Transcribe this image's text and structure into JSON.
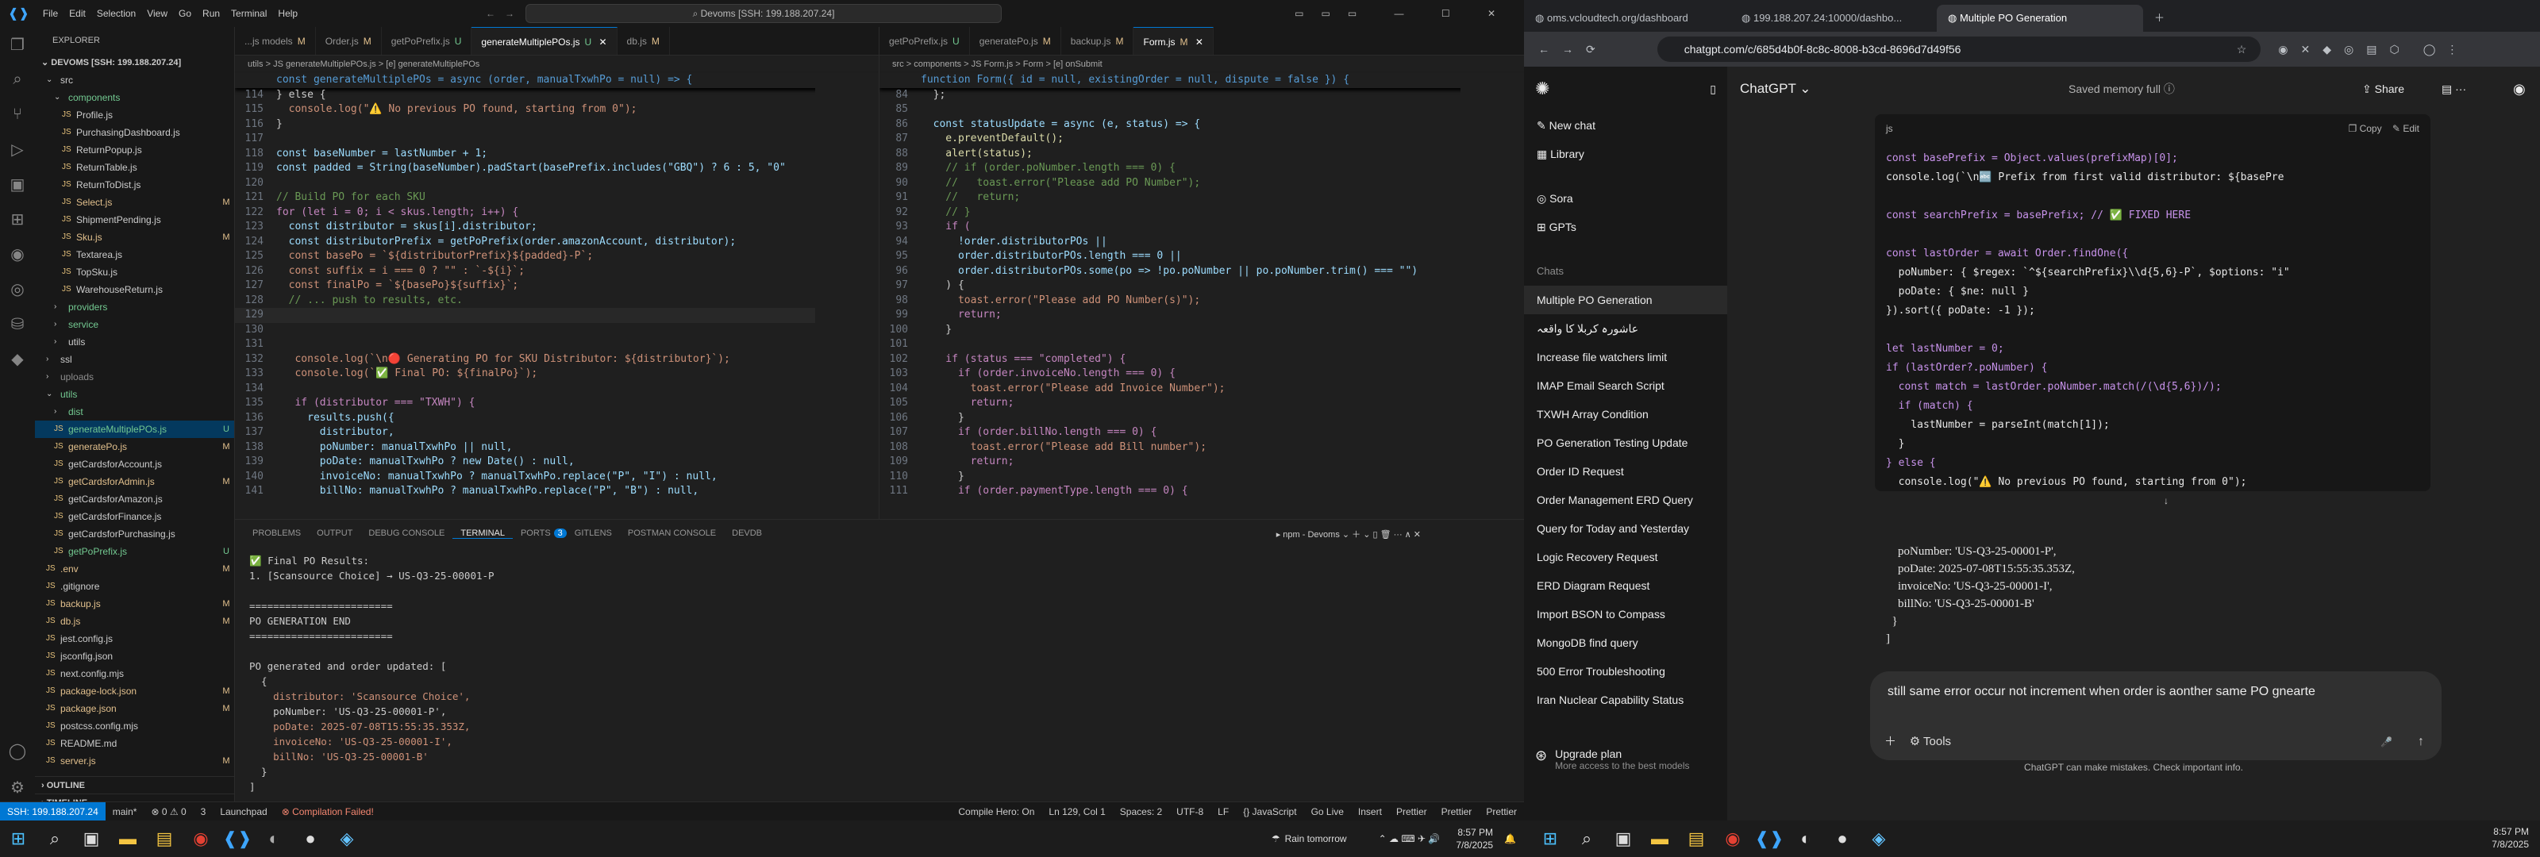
{
  "vscode": {
    "menu": [
      "File",
      "Edit",
      "Selection",
      "View",
      "Go",
      "Run",
      "Terminal",
      "Help"
    ],
    "command_center": "Devoms [SSH: 199.188.207.24]",
    "explorer_title": "EXPLORER",
    "workspace": "DEVOMS [SSH: 199.188.207.24]",
    "tree": [
      {
        "label": "src",
        "indent": 1,
        "folder": true,
        "open": true,
        "status": "",
        "color": "#ccc"
      },
      {
        "label": "components",
        "indent": 2,
        "folder": true,
        "open": true,
        "status": "",
        "color": "#73c991"
      },
      {
        "label": "Profile.js",
        "indent": 3,
        "folder": false,
        "status": "",
        "color": "#ccc"
      },
      {
        "label": "PurchasingDashboard.js",
        "indent": 3,
        "folder": false,
        "status": "",
        "color": "#ccc"
      },
      {
        "label": "ReturnPopup.js",
        "indent": 3,
        "folder": false,
        "status": "",
        "color": "#ccc"
      },
      {
        "label": "ReturnTable.js",
        "indent": 3,
        "folder": false,
        "status": "",
        "color": "#ccc"
      },
      {
        "label": "ReturnToDist.js",
        "indent": 3,
        "folder": false,
        "status": "",
        "color": "#ccc"
      },
      {
        "label": "Select.js",
        "indent": 3,
        "folder": false,
        "status": "M",
        "color": "#e2c08d"
      },
      {
        "label": "ShipmentPending.js",
        "indent": 3,
        "folder": false,
        "status": "",
        "color": "#ccc"
      },
      {
        "label": "Sku.js",
        "indent": 3,
        "folder": false,
        "status": "M",
        "color": "#e2c08d"
      },
      {
        "label": "Textarea.js",
        "indent": 3,
        "folder": false,
        "status": "",
        "color": "#ccc"
      },
      {
        "label": "TopSku.js",
        "indent": 3,
        "folder": false,
        "status": "",
        "color": "#ccc"
      },
      {
        "label": "WarehouseReturn.js",
        "indent": 3,
        "folder": false,
        "status": "",
        "color": "#ccc"
      },
      {
        "label": "providers",
        "indent": 2,
        "folder": true,
        "open": false,
        "status": "",
        "color": "#73c991"
      },
      {
        "label": "service",
        "indent": 2,
        "folder": true,
        "open": false,
        "status": "",
        "color": "#73c991"
      },
      {
        "label": "utils",
        "indent": 2,
        "folder": true,
        "open": false,
        "status": "",
        "color": "#ccc"
      },
      {
        "label": "ssl",
        "indent": 1,
        "folder": true,
        "open": false,
        "status": "",
        "color": "#ccc"
      },
      {
        "label": "uploads",
        "indent": 1,
        "folder": true,
        "open": false,
        "status": "",
        "color": "#8c8c8c"
      },
      {
        "label": "utils",
        "indent": 1,
        "folder": true,
        "open": true,
        "status": "",
        "color": "#73c991"
      },
      {
        "label": "dist",
        "indent": 2,
        "folder": true,
        "open": false,
        "status": "",
        "color": "#73c991"
      },
      {
        "label": "generateMultiplePOs.js",
        "indent": 2,
        "folder": false,
        "status": "U",
        "color": "#73c991",
        "selected": true
      },
      {
        "label": "generatePo.js",
        "indent": 2,
        "folder": false,
        "status": "M",
        "color": "#e2c08d"
      },
      {
        "label": "getCardsforAccount.js",
        "indent": 2,
        "folder": false,
        "status": "",
        "color": "#ccc"
      },
      {
        "label": "getCardsforAdmin.js",
        "indent": 2,
        "folder": false,
        "status": "M",
        "color": "#e2c08d"
      },
      {
        "label": "getCardsforAmazon.js",
        "indent": 2,
        "folder": false,
        "status": "",
        "color": "#ccc"
      },
      {
        "label": "getCardsforFinance.js",
        "indent": 2,
        "folder": false,
        "status": "",
        "color": "#ccc"
      },
      {
        "label": "getCardsforPurchasing.js",
        "indent": 2,
        "folder": false,
        "status": "",
        "color": "#ccc"
      },
      {
        "label": "getPoPrefix.js",
        "indent": 2,
        "folder": false,
        "status": "U",
        "color": "#73c991"
      },
      {
        "label": ".env",
        "indent": 1,
        "folder": false,
        "status": "M",
        "color": "#e2c08d"
      },
      {
        "label": ".gitignore",
        "indent": 1,
        "folder": false,
        "status": "",
        "color": "#ccc"
      },
      {
        "label": "backup.js",
        "indent": 1,
        "folder": false,
        "status": "M",
        "color": "#e2c08d"
      },
      {
        "label": "db.js",
        "indent": 1,
        "folder": false,
        "status": "M",
        "color": "#e2c08d"
      },
      {
        "label": "jest.config.js",
        "indent": 1,
        "folder": false,
        "status": "",
        "color": "#ccc"
      },
      {
        "label": "jsconfig.json",
        "indent": 1,
        "folder": false,
        "status": "",
        "color": "#ccc"
      },
      {
        "label": "next.config.mjs",
        "indent": 1,
        "folder": false,
        "status": "",
        "color": "#ccc"
      },
      {
        "label": "package-lock.json",
        "indent": 1,
        "folder": false,
        "status": "M",
        "color": "#e2c08d"
      },
      {
        "label": "package.json",
        "indent": 1,
        "folder": false,
        "status": "M",
        "color": "#e2c08d"
      },
      {
        "label": "postcss.config.mjs",
        "indent": 1,
        "folder": false,
        "status": "",
        "color": "#ccc"
      },
      {
        "label": "README.md",
        "indent": 1,
        "folder": false,
        "status": "",
        "color": "#ccc"
      },
      {
        "label": "server.js",
        "indent": 1,
        "folder": false,
        "status": "M",
        "color": "#e2c08d"
      }
    ],
    "outline": "OUTLINE",
    "timeline": "TIMELINE",
    "tabs_left": [
      {
        "label": "...js models",
        "mod": "M",
        "active": false
      },
      {
        "label": "Order.js",
        "mod": "M",
        "active": false
      },
      {
        "label": "getPoPrefix.js",
        "mod": "U",
        "active": false
      },
      {
        "label": "generateMultiplePOs.js",
        "mod": "U",
        "active": true
      },
      {
        "label": "db.js",
        "mod": "M",
        "active": false
      }
    ],
    "tabs_right": [
      {
        "label": "getPoPrefix.js",
        "mod": "U",
        "active": false
      },
      {
        "label": "generatePo.js",
        "mod": "M",
        "active": false
      },
      {
        "label": "backup.js",
        "mod": "M",
        "active": false
      },
      {
        "label": "Form.js",
        "mod": "M",
        "active": true
      }
    ],
    "breadcrumb_left": "utils > JS generateMultiplePOs.js > [e] generateMultiplePOs",
    "breadcrumb_right": "src > components > JS Form.js > Form > [e] onSubmit",
    "code_left_sticky": "const generateMultiplePOs = async (order, manualTxwhPo = null) => {",
    "code_left": [
      {
        "n": "114",
        "t": "} else {",
        "c": "tx"
      },
      {
        "n": "115",
        "t": "  console.log(\"⚠️ No previous PO found, starting from 0\");",
        "c": "str"
      },
      {
        "n": "116",
        "t": "}",
        "c": "tx"
      },
      {
        "n": "117",
        "t": "",
        "c": "tx"
      },
      {
        "n": "118",
        "t": "const baseNumber = lastNumber + 1;",
        "c": "vr"
      },
      {
        "n": "119",
        "t": "const padded = String(baseNumber).padStart(basePrefix.includes(\"GBQ\") ? 6 : 5, \"0\"",
        "c": "vr"
      },
      {
        "n": "120",
        "t": "",
        "c": "tx"
      },
      {
        "n": "121",
        "t": "// Build PO for each SKU",
        "c": "cm"
      },
      {
        "n": "122",
        "t": "for (let i = 0; i < skus.length; i++) {",
        "c": "ctl"
      },
      {
        "n": "123",
        "t": "  const distributor = skus[i].distributor;",
        "c": "vr"
      },
      {
        "n": "124",
        "t": "  const distributorPrefix = getPoPrefix(order.amazonAccount, distributor);",
        "c": "vr"
      },
      {
        "n": "125",
        "t": "  const basePo = `${distributorPrefix}${padded}-P`;",
        "c": "str"
      },
      {
        "n": "126",
        "t": "  const suffix = i === 0 ? \"\" : `-${i}`;",
        "c": "str"
      },
      {
        "n": "127",
        "t": "  const finalPo = `${basePo}${suffix}`;",
        "c": "str"
      },
      {
        "n": "128",
        "t": "  // ... push to results, etc.",
        "c": "cm"
      },
      {
        "n": "129",
        "t": "",
        "c": "cur"
      },
      {
        "n": "130",
        "t": "",
        "c": "tx"
      },
      {
        "n": "131",
        "t": "",
        "c": "tx"
      },
      {
        "n": "132",
        "t": "   console.log(`\\n🔴 Generating PO for SKU Distributor: ${distributor}`);",
        "c": "str"
      },
      {
        "n": "133",
        "t": "   console.log(`✅ Final PO: ${finalPo}`);",
        "c": "str"
      },
      {
        "n": "134",
        "t": "",
        "c": "tx"
      },
      {
        "n": "135",
        "t": "   if (distributor === \"TXWH\") {",
        "c": "ctl"
      },
      {
        "n": "136",
        "t": "     results.push({",
        "c": "vr"
      },
      {
        "n": "137",
        "t": "       distributor,",
        "c": "vr"
      },
      {
        "n": "138",
        "t": "       poNumber: manualTxwhPo || null,",
        "c": "vr"
      },
      {
        "n": "139",
        "t": "       poDate: manualTxwhPo ? new Date() : null,",
        "c": "vr"
      },
      {
        "n": "140",
        "t": "       invoiceNo: manualTxwhPo ? manualTxwhPo.replace(\"P\", \"I\") : null,",
        "c": "vr"
      },
      {
        "n": "141",
        "t": "       billNo: manualTxwhPo ? manualTxwhPo.replace(\"P\", \"B\") : null,",
        "c": "vr"
      }
    ],
    "code_right_sticky": "function Form({ id = null, existingOrder = null, dispute = false }) {",
    "code_right": [
      {
        "n": "84",
        "t": "  };",
        "c": "tx"
      },
      {
        "n": "85",
        "t": "",
        "c": "tx"
      },
      {
        "n": "86",
        "t": "  const statusUpdate = async (e, status) => {",
        "c": "vr"
      },
      {
        "n": "87",
        "t": "    e.preventDefault();",
        "c": "fn"
      },
      {
        "n": "88",
        "t": "    alert(status);",
        "c": "fn"
      },
      {
        "n": "89",
        "t": "    // if (order.poNumber.length === 0) {",
        "c": "cm"
      },
      {
        "n": "90",
        "t": "    //   toast.error(\"Please add PO Number\");",
        "c": "cm"
      },
      {
        "n": "91",
        "t": "    //   return;",
        "c": "cm"
      },
      {
        "n": "92",
        "t": "    // }",
        "c": "cm"
      },
      {
        "n": "93",
        "t": "    if (",
        "c": "ctl"
      },
      {
        "n": "94",
        "t": "      !order.distributorPOs ||",
        "c": "vr"
      },
      {
        "n": "95",
        "t": "      order.distributorPOs.length === 0 ||",
        "c": "vr"
      },
      {
        "n": "96",
        "t": "      order.distributorPOs.some(po => !po.poNumber || po.poNumber.trim() === \"\")",
        "c": "vr"
      },
      {
        "n": "97",
        "t": "    ) {",
        "c": "tx"
      },
      {
        "n": "98",
        "t": "      toast.error(\"Please add PO Number(s)\");",
        "c": "str"
      },
      {
        "n": "99",
        "t": "      return;",
        "c": "ctl"
      },
      {
        "n": "100",
        "t": "    }",
        "c": "tx"
      },
      {
        "n": "101",
        "t": "",
        "c": "tx"
      },
      {
        "n": "102",
        "t": "    if (status === \"completed\") {",
        "c": "ctl"
      },
      {
        "n": "103",
        "t": "      if (order.invoiceNo.length === 0) {",
        "c": "ctl"
      },
      {
        "n": "104",
        "t": "        toast.error(\"Please add Invoice Number\");",
        "c": "str"
      },
      {
        "n": "105",
        "t": "        return;",
        "c": "ctl"
      },
      {
        "n": "106",
        "t": "      }",
        "c": "tx"
      },
      {
        "n": "107",
        "t": "      if (order.billNo.length === 0) {",
        "c": "ctl"
      },
      {
        "n": "108",
        "t": "        toast.error(\"Please add Bill number\");",
        "c": "str"
      },
      {
        "n": "109",
        "t": "        return;",
        "c": "ctl"
      },
      {
        "n": "110",
        "t": "      }",
        "c": "tx"
      },
      {
        "n": "111",
        "t": "      if (order.paymentType.length === 0) {",
        "c": "ctl"
      }
    ],
    "panel_tabs": [
      "PROBLEMS",
      "OUTPUT",
      "DEBUG CONSOLE",
      "TERMINAL",
      "PORTS",
      "GITLENS",
      "POSTMAN CONSOLE",
      "DEVDB"
    ],
    "ports_count": "3",
    "terminal_name": "npm - Devoms",
    "terminal_lines": [
      "✅ Final PO Results:",
      "1. [Scansource Choice] → US-Q3-25-00001-P",
      "",
      "========================",
      "PO GENERATION END",
      "========================",
      "",
      "PO generated and order updated: [",
      "  {",
      "    distributor: 'Scansource Choice',",
      "    poNumber: 'US-Q3-25-00001-P',",
      "    poDate: 2025-07-08T15:55:35.353Z,",
      "    invoiceNo: 'US-Q3-25-00001-I',",
      "    billNo: 'US-Q3-25-00001-B'",
      "  }",
      "]",
      ""
    ],
    "status_left": [
      "SSH: 199.188.207.24",
      "main*",
      "⊗ 0 ⚠ 0",
      "3",
      "Launchpad",
      "⊗ Compilation Failed!"
    ],
    "status_right": [
      "Compile Hero: On",
      "Ln 129, Col 1",
      "Spaces: 2",
      "UTF-8",
      "LF",
      "{} JavaScript",
      "Go Live",
      "Insert",
      "Prettier",
      "Prettier",
      "Prettier"
    ]
  },
  "taskbar_left": {
    "weather": "Rain tomorrow",
    "time": "8:57 PM",
    "date": "7/8/2025"
  },
  "chrome": {
    "tabs": [
      {
        "label": "oms.vcloudtech.org/dashboard",
        "active": false
      },
      {
        "label": "199.188.207.24:10000/dashbo...",
        "active": false
      },
      {
        "label": "Multiple PO Generation",
        "active": true
      }
    ],
    "url": "chatgpt.com/c/685d4b0f-8c8c-8008-b3cd-8696d7d49f56"
  },
  "chatgpt": {
    "model": "ChatGPT",
    "memory": "Saved memory full",
    "share": "Share",
    "side_items": [
      "New chat",
      "Library",
      "Sora",
      "GPTs"
    ],
    "chats_header": "Chats",
    "chats": [
      "Multiple PO Generation",
      "عاشورہ کربلا کا واقعہ",
      "Increase file watchers limit",
      "IMAP Email Search Script",
      "TXWH Array Condition",
      "PO Generation Testing Update",
      "Order ID Request",
      "Order Management ERD Query",
      "Query for Today and Yesterday",
      "Logic Recovery Request",
      "ERD Diagram Request",
      "Import BSON to Compass",
      "MongoDB find query",
      "500 Error Troubleshooting",
      "Iran Nuclear Capability Status"
    ],
    "upgrade_title": "Upgrade plan",
    "upgrade_sub": "More access to the best models",
    "code_lang": "js",
    "copy": "Copy",
    "edit": "Edit",
    "code_lines": [
      "const basePrefix = Object.values(prefixMap)[0];",
      "console.log(`\\n🔤 Prefix from first valid distributor: ${basePre",
      "",
      "const searchPrefix = basePrefix; // ✅ FIXED HERE",
      "",
      "const lastOrder = await Order.findOne({",
      "  poNumber: { $regex: `^${searchPrefix}\\\\d{5,6}-P`, $options: \"i\"",
      "  poDate: { $ne: null }",
      "}).sort({ poDate: -1 });",
      "",
      "let lastNumber = 0;",
      "if (lastOrder?.poNumber) {",
      "  const match = lastOrder.poNumber.match(/(\\d{5,6})/);",
      "  if (match) {",
      "    lastNumber = parseInt(match[1]);",
      "  }",
      "} else {",
      "  console.log(\"⚠️ No previous PO found, starting from 0\");",
      "}"
    ],
    "msg_lines": [
      "    poNumber: 'US-Q3-25-00001-P',",
      "    poDate: 2025-07-08T15:55:35.353Z,",
      "    invoiceNo: 'US-Q3-25-00001-I',",
      "    billNo: 'US-Q3-25-00001-B'",
      "  }",
      "]"
    ],
    "composer_text": "still same error occur not increment when order is aonther same PO gnearte",
    "tools": "Tools",
    "disclaimer": "ChatGPT can make mistakes. Check important info."
  },
  "taskbar_right": {
    "time": "8:57 PM",
    "date": "7/8/2025"
  }
}
